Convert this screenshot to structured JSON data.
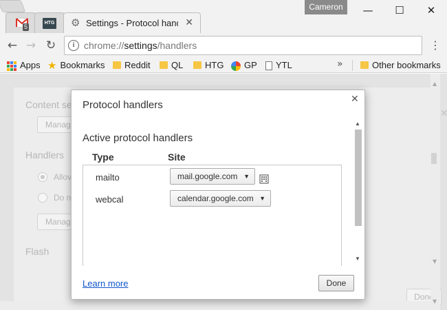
{
  "tabs": [
    {
      "title": "",
      "badge": "5",
      "icon": "gmail-icon"
    },
    {
      "title": "",
      "icon": "htg-icon",
      "icon_text": "HTG"
    },
    {
      "title": "Settings - Protocol handlers",
      "icon": "gear-icon",
      "active": true
    }
  ],
  "profile": {
    "name": "Cameron"
  },
  "toolbar": {
    "url_scheme": "chrome://",
    "url_host": "settings",
    "url_path": "/handlers"
  },
  "bookmarks": {
    "items": [
      {
        "label": "Apps",
        "icon": "apps-icon"
      },
      {
        "label": "Bookmarks",
        "icon": "star-icon"
      },
      {
        "label": "Reddit",
        "icon": "folder-icon"
      },
      {
        "label": "QL",
        "icon": "folder-icon"
      },
      {
        "label": "HTG",
        "icon": "folder-icon"
      },
      {
        "label": "GP",
        "icon": "photos-icon"
      },
      {
        "label": "YTL",
        "icon": "page-icon"
      }
    ],
    "overflow": "»",
    "other": "Other bookmarks"
  },
  "background": {
    "content_settings": "Content se",
    "manage_1": "Manag",
    "handlers": "Handlers",
    "allow": "Allov",
    "do_not": "Do n",
    "manage_2": "Manag",
    "flash": "Flash",
    "done": "Done"
  },
  "dialog": {
    "title": "Protocol handlers",
    "section": "Active protocol handlers",
    "col_type": "Type",
    "col_site": "Site",
    "handlers": [
      {
        "type": "mailto",
        "site": "mail.google.com"
      },
      {
        "type": "webcal",
        "site": "calendar.google.com"
      }
    ],
    "learn_more": "Learn more",
    "done": "Done"
  },
  "colors": {
    "accent_link": "#1155cc",
    "folder": "#f6c644",
    "profile_bg": "#8a8a8a"
  }
}
